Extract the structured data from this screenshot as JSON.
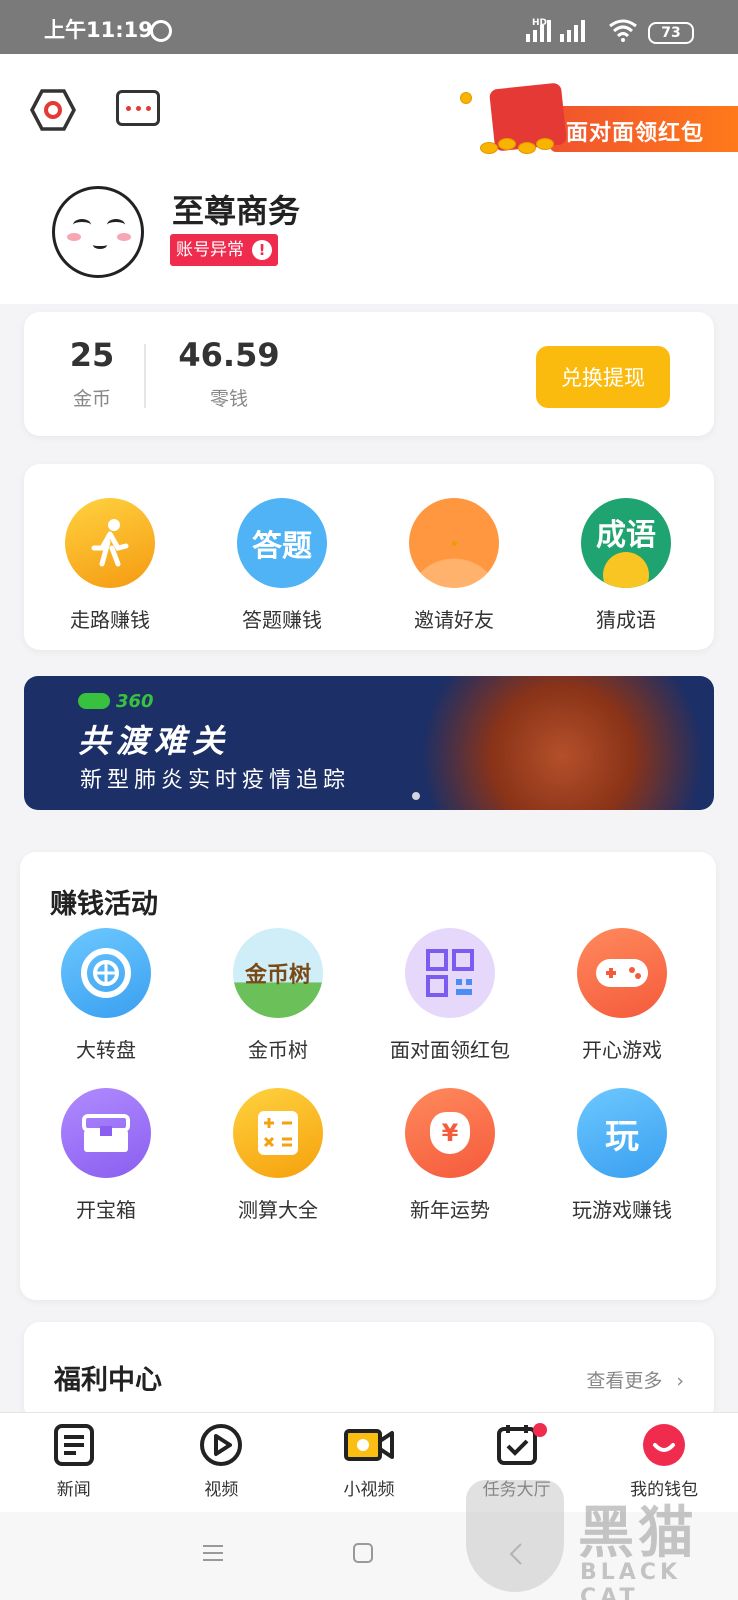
{
  "status_bar": {
    "time": "上午11:19",
    "hd": "HD",
    "battery": "73"
  },
  "promo": {
    "label": "面对面领红包"
  },
  "user": {
    "name": "至尊商务",
    "badge": "账号异常",
    "badge_icon": "!"
  },
  "wallet": {
    "coins_value": "25",
    "coins_label": "金币",
    "change_value": "46.59",
    "change_label": "零钱",
    "exchange_button": "兑换提现"
  },
  "quick_actions": [
    {
      "label": "走路赚钱",
      "icon": "walking-person-icon",
      "color": "#fbb21a"
    },
    {
      "label": "答题赚钱",
      "icon": "quiz-icon",
      "text": "答题",
      "color": "#4fb3f5"
    },
    {
      "label": "邀请好友",
      "icon": "invite-icon",
      "color": "#ff9a44"
    },
    {
      "label": "猜成语",
      "icon": "idiom-icon",
      "text": "成语",
      "color": "#1fa371"
    }
  ],
  "banner": {
    "brand": "360",
    "title": "共渡难关",
    "subtitle": "新型肺炎实时疫情追踪"
  },
  "earn_section": {
    "title": "赚钱活动",
    "items": [
      {
        "label": "大转盘",
        "icon": "spin-wheel-icon",
        "color": "#4cb1f5"
      },
      {
        "label": "金币树",
        "icon": "coin-tree-icon",
        "text": "金币树",
        "color": "#b9e6f5"
      },
      {
        "label": "面对面领红包",
        "icon": "qr-code-icon",
        "color": "#e3d4fa"
      },
      {
        "label": "开心游戏",
        "icon": "gamepad-icon",
        "color": "#fb7048"
      },
      {
        "label": "开宝箱",
        "icon": "treasure-chest-icon",
        "color": "#9a6ef0"
      },
      {
        "label": "测算大全",
        "icon": "calculator-icon",
        "color": "#fbb80f"
      },
      {
        "label": "新年运势",
        "icon": "money-bag-icon",
        "text": "¥",
        "color": "#fb6a48"
      },
      {
        "label": "玩游戏赚钱",
        "icon": "play-game-icon",
        "text": "玩",
        "color": "#4cb1f5"
      }
    ]
  },
  "welfare": {
    "title": "福利中心",
    "more": "查看更多"
  },
  "tabs": [
    {
      "label": "新闻",
      "icon": "news-icon"
    },
    {
      "label": "视频",
      "icon": "video-play-icon"
    },
    {
      "label": "小视频",
      "icon": "small-video-icon"
    },
    {
      "label": "任务大厅",
      "icon": "task-calendar-icon"
    },
    {
      "label": "我的钱包",
      "icon": "wallet-smile-icon"
    }
  ],
  "watermark": {
    "cn": "黑猫",
    "en": "BLACK CAT"
  }
}
